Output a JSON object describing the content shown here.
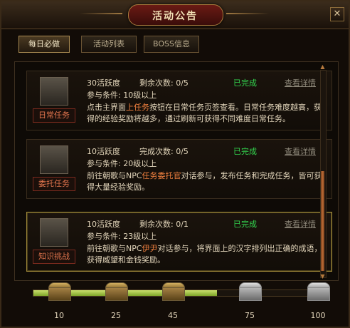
{
  "window": {
    "title": "活动公告",
    "close": "✕"
  },
  "tabs": [
    {
      "label": "每日必做"
    },
    {
      "label": "活动列表"
    },
    {
      "label": "BOSS信息"
    }
  ],
  "entries": [
    {
      "name": "日常任务",
      "activity": "30活跃度",
      "count_label": "剩余次数: 0/5",
      "status": "已完成",
      "detail": "查看详情",
      "condition": "参与条件: 10级以上",
      "desc_pre": "点击主界面",
      "desc_em": "上任务",
      "desc_post": "按钮在日常任务页签查看。日常任务难度越高，获得的经验奖励将越多，通过刷新可获得不同难度日常任务。"
    },
    {
      "name": "委托任务",
      "activity": "10活跃度",
      "count_label": "完成次数: 0/5",
      "status": "已完成",
      "detail": "查看详情",
      "condition": "参与条件: 20级以上",
      "desc_pre": "前往朝歌与NPC",
      "desc_em": "任务委托官",
      "desc_post": "对话参与，发布任务和完成任务，皆可获得大量经验奖励。"
    },
    {
      "name": "知识挑战",
      "activity": "10活跃度",
      "count_label": "剩余次数: 0/1",
      "status": "已完成",
      "detail": "查看详情",
      "condition": "参与条件: 23级以上",
      "desc_pre": "前往朝歌与NPC",
      "desc_em": "伊尹",
      "desc_post": "对话参与，将界面上的汉字排列出正确的成语，获得威望和金钱奖励。"
    }
  ],
  "progress": {
    "fill_fraction": 0.62,
    "milestones": [
      {
        "label": "10",
        "opened": true
      },
      {
        "label": "25",
        "opened": true
      },
      {
        "label": "45",
        "opened": true
      },
      {
        "label": "75",
        "opened": false
      },
      {
        "label": "100",
        "opened": false
      }
    ]
  },
  "colors": {
    "completed": "#33d34d",
    "highlight": "#f0803f",
    "accent": "#a88a52"
  },
  "icons": {
    "close": "close-icon",
    "scroll_up": "arrow-up-icon",
    "scroll_down": "arrow-down-icon",
    "chest": "treasure-chest-icon"
  }
}
